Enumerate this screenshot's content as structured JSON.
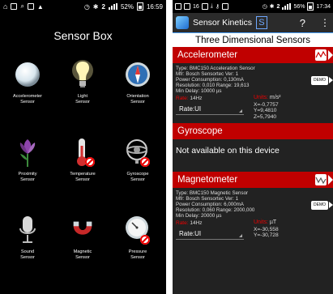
{
  "left_screen": {
    "statusbar": {
      "battery": "52%",
      "time": "16:59"
    },
    "title": "Sensor Box",
    "sensors": [
      {
        "label_line1": "Accelerometer",
        "label_line2": "Sensor",
        "icon": "sphere-icon"
      },
      {
        "label_line1": "Light",
        "label_line2": "Sensor",
        "icon": "lightbulb-icon"
      },
      {
        "label_line1": "Orientation",
        "label_line2": "Sensor",
        "icon": "compass-icon"
      },
      {
        "label_line1": "Proximity",
        "label_line2": "Sensor",
        "icon": "flower-icon"
      },
      {
        "label_line1": "Temperature",
        "label_line2": "Sensor",
        "icon": "thermometer-icon",
        "disabled": true
      },
      {
        "label_line1": "Gyroscope",
        "label_line2": "Sensor",
        "icon": "gyroscope-icon",
        "disabled": true
      },
      {
        "label_line1": "Sound",
        "label_line2": "Sensor",
        "icon": "microphone-icon"
      },
      {
        "label_line1": "Magnetic",
        "label_line2": "Sensor",
        "icon": "magnet-icon"
      },
      {
        "label_line1": "Pressure",
        "label_line2": "Sensor",
        "icon": "pressure-gauge-icon",
        "disabled": true
      }
    ]
  },
  "right_screen": {
    "statusbar": {
      "date": "16",
      "battery": "56%",
      "time": "17:34"
    },
    "app_title": "Sensor Kinetics",
    "s_button": "S",
    "help": "?",
    "overflow": "⋮",
    "header": "Three Dimensional Sensors",
    "accelerometer": {
      "title": "Accelerometer",
      "info": [
        "Type: BMC150 Acceleration Sensor",
        "Mfr: Bosch Sensortec  Ver: 1",
        "Power Consumption: 0,130mA",
        "Resolution: 0,010  Range: 19,613",
        "Min Delay: 10000 µs"
      ],
      "demo": "DEMO",
      "rate_label": "Rate:",
      "rate_value": "14Hz",
      "units_label": "Units:",
      "units_value": "m/s²",
      "rate_select": "Rate:UI",
      "x": "X=-0,7757",
      "y": "Y=9,4810",
      "z": "Z=5,7940"
    },
    "gyroscope": {
      "title": "Gyroscope",
      "message": "Not available on this device"
    },
    "magnetometer": {
      "title": "Magnetometer",
      "info": [
        "Type: BMC150 Magnetic Sensor",
        "Mfr: Bosch Sensortec  Ver: 1",
        "Power Consumption: 6,000mA",
        "Resolution: 0,060  Range: 2000,000",
        "Min Delay: 20000 µs"
      ],
      "demo": "DEMO",
      "rate_label": "Rate:",
      "rate_value": "14Hz",
      "units_label": "Units:",
      "units_value": "µT",
      "rate_select": "Rate:UI",
      "x": "X=-30,558",
      "y": "Y=-30,728"
    }
  },
  "colors": {
    "section_red": "#c00000",
    "accent_blue": "#4aa0ff"
  }
}
